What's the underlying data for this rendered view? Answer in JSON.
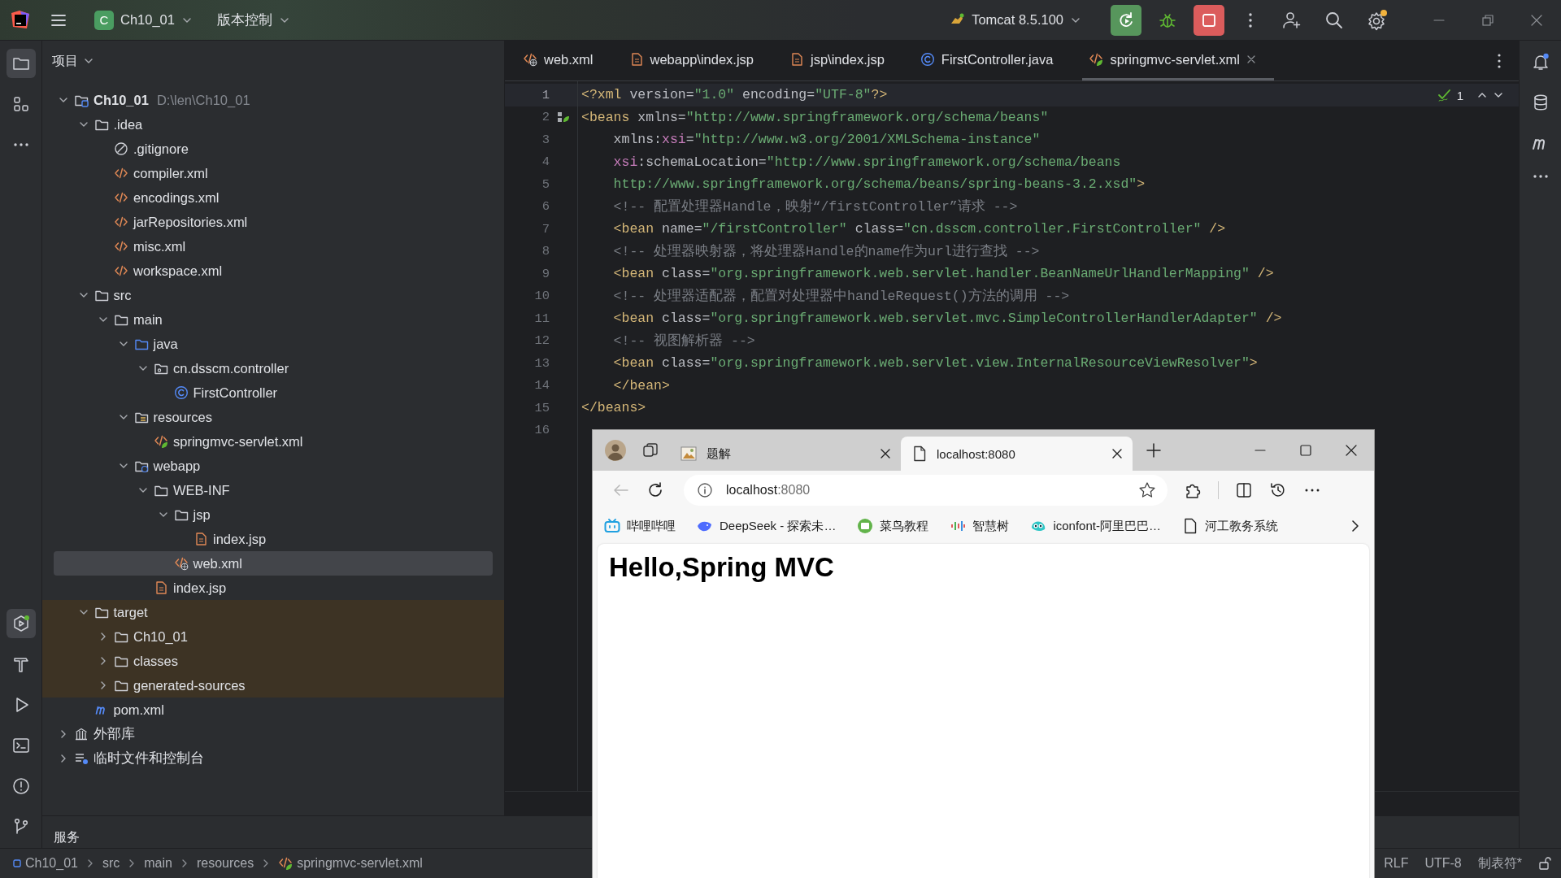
{
  "title_bar": {
    "project_badge": "C",
    "project": "Ch10_01",
    "vcs": "版本控制",
    "run_config": "Tomcat 8.5.100"
  },
  "left_toolbar": {
    "top": [
      {
        "kind": "folder",
        "selected": true
      },
      {
        "kind": "structure",
        "selected": false
      },
      {
        "kind": "more",
        "selected": false
      }
    ],
    "bottom": [
      {
        "kind": "services",
        "selected": true
      },
      {
        "kind": "build",
        "selected": false
      },
      {
        "kind": "run",
        "selected": false
      },
      {
        "kind": "terminal",
        "selected": false
      },
      {
        "kind": "problems",
        "selected": false
      },
      {
        "kind": "git",
        "selected": false
      }
    ]
  },
  "project_panel": {
    "title": "项目",
    "tree": [
      {
        "label": "Ch10_01",
        "path": "D:\\len\\Ch10_01",
        "kind": "module",
        "expanded": true,
        "selected": false,
        "excluded": false,
        "children": [
          {
            "label": ".idea",
            "kind": "folder",
            "expanded": true,
            "selected": false,
            "excluded": false,
            "children": [
              {
                "label": ".gitignore",
                "kind": "ignore",
                "selected": false,
                "excluded": false
              },
              {
                "label": "compiler.xml",
                "kind": "xml",
                "selected": false,
                "excluded": false
              },
              {
                "label": "encodings.xml",
                "kind": "xml",
                "selected": false,
                "excluded": false
              },
              {
                "label": "jarRepositories.xml",
                "kind": "xml",
                "selected": false,
                "excluded": false
              },
              {
                "label": "misc.xml",
                "kind": "xml",
                "selected": false,
                "excluded": false
              },
              {
                "label": "workspace.xml",
                "kind": "xml",
                "selected": false,
                "excluded": false
              }
            ]
          },
          {
            "label": "src",
            "kind": "folder",
            "expanded": true,
            "selected": false,
            "excluded": false,
            "children": [
              {
                "label": "main",
                "kind": "folder",
                "expanded": true,
                "selected": false,
                "excluded": false,
                "children": [
                  {
                    "label": "java",
                    "kind": "source",
                    "expanded": true,
                    "selected": false,
                    "excluded": false,
                    "children": [
                      {
                        "label": "cn.dsscm.controller",
                        "kind": "package",
                        "expanded": true,
                        "selected": false,
                        "excluded": false,
                        "children": [
                          {
                            "label": "FirstController",
                            "kind": "class",
                            "selected": false,
                            "excluded": false
                          }
                        ]
                      }
                    ]
                  },
                  {
                    "label": "resources",
                    "kind": "resources",
                    "expanded": true,
                    "selected": false,
                    "excluded": false,
                    "children": [
                      {
                        "label": "springmvc-servlet.xml",
                        "kind": "spring",
                        "selected": false,
                        "excluded": false
                      }
                    ]
                  },
                  {
                    "label": "webapp",
                    "kind": "web",
                    "expanded": true,
                    "selected": false,
                    "excluded": false,
                    "children": [
                      {
                        "label": "WEB-INF",
                        "kind": "folder",
                        "expanded": true,
                        "selected": false,
                        "excluded": false,
                        "children": [
                          {
                            "label": "jsp",
                            "kind": "folder",
                            "expanded": true,
                            "selected": false,
                            "excluded": false,
                            "children": [
                              {
                                "label": "index.jsp",
                                "kind": "jsp",
                                "selected": false,
                                "excluded": false
                              }
                            ]
                          },
                          {
                            "label": "web.xml",
                            "kind": "webxml",
                            "selected": true,
                            "excluded": false
                          }
                        ]
                      },
                      {
                        "label": "index.jsp",
                        "kind": "jsp",
                        "selected": false,
                        "excluded": false
                      }
                    ]
                  }
                ]
              }
            ]
          },
          {
            "label": "target",
            "kind": "folder",
            "expanded": true,
            "selected": false,
            "excluded": true,
            "children": [
              {
                "label": "Ch10_01",
                "kind": "folder",
                "expanded": false,
                "selected": false,
                "excluded": true
              },
              {
                "label": "classes",
                "kind": "folder",
                "expanded": false,
                "selected": false,
                "excluded": true
              },
              {
                "label": "generated-sources",
                "kind": "folder",
                "expanded": false,
                "selected": false,
                "excluded": true
              }
            ]
          },
          {
            "label": "pom.xml",
            "kind": "maven",
            "selected": false,
            "excluded": false
          }
        ]
      },
      {
        "label": "外部库",
        "kind": "library",
        "expanded": false,
        "selected": false,
        "excluded": false
      },
      {
        "label": "临时文件和控制台",
        "kind": "scratch",
        "expanded": false,
        "selected": false,
        "excluded": false
      }
    ]
  },
  "editor": {
    "tabs": [
      {
        "label": "web.xml",
        "kind": "webxml",
        "selected": false
      },
      {
        "label": "webapp\\index.jsp",
        "kind": "jsp",
        "selected": false
      },
      {
        "label": "jsp\\index.jsp",
        "kind": "jsp",
        "selected": false
      },
      {
        "label": "FirstController.java",
        "kind": "class",
        "selected": false
      },
      {
        "label": "springmvc-servlet.xml",
        "kind": "spring",
        "selected": true
      }
    ],
    "inspection_count": "1",
    "lines": [
      {
        "number": "1",
        "indent": false,
        "gutter_marker": false,
        "tokens": [
          {
            "kind": "tag",
            "t": "<?xml"
          },
          {
            "kind": "attr",
            "t": " version"
          },
          {
            "kind": "plain",
            "t": "="
          },
          {
            "kind": "str",
            "t": "\"1.0\""
          },
          {
            "kind": "attr",
            "t": " encoding"
          },
          {
            "kind": "plain",
            "t": "="
          },
          {
            "kind": "str",
            "t": "\"UTF-8\""
          },
          {
            "kind": "tag",
            "t": "?>"
          }
        ]
      },
      {
        "number": "2",
        "indent": false,
        "gutter_marker": true,
        "tokens": [
          {
            "kind": "tag",
            "t": "<beans"
          },
          {
            "kind": "attr",
            "t": " xmlns"
          },
          {
            "kind": "plain",
            "t": "="
          },
          {
            "kind": "str",
            "t": "\"http://www.springframework.org/schema/beans\""
          }
        ]
      },
      {
        "number": "3",
        "indent": true,
        "gutter_marker": false,
        "tokens": [
          {
            "kind": "attr",
            "t": "xmlns"
          },
          {
            "kind": "plain",
            "t": ":"
          },
          {
            "kind": "ns",
            "t": "xsi"
          },
          {
            "kind": "plain",
            "t": "="
          },
          {
            "kind": "str",
            "t": "\"http://www.w3.org/2001/XMLSchema-instance\""
          }
        ]
      },
      {
        "number": "4",
        "indent": true,
        "gutter_marker": false,
        "tokens": [
          {
            "kind": "ns",
            "t": "xsi"
          },
          {
            "kind": "attr",
            "t": ":schemaLocation"
          },
          {
            "kind": "plain",
            "t": "="
          },
          {
            "kind": "str",
            "t": "\"http://www.springframework.org/schema/beans"
          }
        ]
      },
      {
        "number": "5",
        "indent": true,
        "gutter_marker": false,
        "tokens": [
          {
            "kind": "str",
            "t": "http://www.springframework.org/schema/beans/spring-beans-3.2.xsd\""
          },
          {
            "kind": "tag",
            "t": ">"
          }
        ]
      },
      {
        "number": "6",
        "indent": true,
        "gutter_marker": false,
        "tokens": [
          {
            "kind": "cmt",
            "t": "<!-- 配置处理器Handle，映射“/firstController”请求 -->"
          }
        ]
      },
      {
        "number": "7",
        "indent": true,
        "gutter_marker": false,
        "tokens": [
          {
            "kind": "tag",
            "t": "<bean"
          },
          {
            "kind": "attr",
            "t": " name"
          },
          {
            "kind": "plain",
            "t": "="
          },
          {
            "kind": "str",
            "t": "\"/firstController\""
          },
          {
            "kind": "attr",
            "t": " class"
          },
          {
            "kind": "plain",
            "t": "="
          },
          {
            "kind": "str",
            "t": "\"cn.dsscm.controller.FirstController\""
          },
          {
            "kind": "tag",
            "t": " />"
          }
        ]
      },
      {
        "number": "8",
        "indent": true,
        "gutter_marker": false,
        "tokens": [
          {
            "kind": "cmt",
            "t": "<!-- 处理器映射器，将处理器Handle的name作为url进行查找 -->"
          }
        ]
      },
      {
        "number": "9",
        "indent": true,
        "gutter_marker": false,
        "tokens": [
          {
            "kind": "tag",
            "t": "<bean"
          },
          {
            "kind": "attr",
            "t": " class"
          },
          {
            "kind": "plain",
            "t": "="
          },
          {
            "kind": "str",
            "t": "\"org.springframework.web.servlet.handler.BeanNameUrlHandlerMapping\""
          },
          {
            "kind": "tag",
            "t": " />"
          }
        ]
      },
      {
        "number": "10",
        "indent": true,
        "gutter_marker": false,
        "tokens": [
          {
            "kind": "cmt",
            "t": "<!-- 处理器适配器，配置对处理器中handleRequest()方法的调用 -->"
          }
        ]
      },
      {
        "number": "11",
        "indent": true,
        "gutter_marker": false,
        "tokens": [
          {
            "kind": "tag",
            "t": "<bean"
          },
          {
            "kind": "attr",
            "t": " class"
          },
          {
            "kind": "plain",
            "t": "="
          },
          {
            "kind": "str",
            "t": "\"org.springframework.web.servlet.mvc.SimpleControllerHandlerAdapter\""
          },
          {
            "kind": "tag",
            "t": " />"
          }
        ]
      },
      {
        "number": "12",
        "indent": true,
        "gutter_marker": false,
        "tokens": [
          {
            "kind": "cmt",
            "t": "<!-- 视图解析器 -->"
          }
        ]
      },
      {
        "number": "13",
        "indent": true,
        "gutter_marker": false,
        "tokens": [
          {
            "kind": "tag",
            "t": "<bean"
          },
          {
            "kind": "attr",
            "t": " class"
          },
          {
            "kind": "plain",
            "t": "="
          },
          {
            "kind": "str",
            "t": "\"org.springframework.web.servlet.view.InternalResourceViewResolver\""
          },
          {
            "kind": "tag",
            "t": ">"
          }
        ]
      },
      {
        "number": "14",
        "indent": true,
        "gutter_marker": false,
        "tokens": [
          {
            "kind": "tag",
            "t": "</bean>"
          }
        ]
      },
      {
        "number": "15",
        "indent": false,
        "gutter_marker": false,
        "tokens": [
          {
            "kind": "tag",
            "t": "</beans>"
          }
        ]
      },
      {
        "number": "16",
        "gutter_marker": false
      }
    ]
  },
  "right_toolbar": [
    {
      "kind": "bell"
    },
    {
      "kind": "database"
    },
    {
      "kind": "maven"
    },
    {
      "kind": "more"
    }
  ],
  "services_panel": {
    "title": "服务"
  },
  "status_bar": {
    "breadcrumbs": [
      {
        "label": "Ch10_01",
        "kind": "module"
      },
      {
        "label": "src",
        "kind": "plain"
      },
      {
        "label": "main",
        "kind": "plain"
      },
      {
        "label": "resources",
        "kind": "plain"
      },
      {
        "label": "springmvc-servlet.xml",
        "kind": "spring"
      }
    ],
    "items": [
      "RLF",
      "UTF-8",
      "制表符*"
    ]
  },
  "browser": {
    "tabs": [
      {
        "label": "题解",
        "kind": "image",
        "selected": false
      },
      {
        "label": "localhost:8080",
        "kind": "page",
        "selected": true
      }
    ],
    "back_disabled": true,
    "address": {
      "host": "localhost",
      "port": ":8080"
    },
    "bookmarks": [
      {
        "label": "哔哩哔哩",
        "kind": "tv"
      },
      {
        "label": "DeepSeek - 探索未…",
        "kind": "whale"
      },
      {
        "label": "菜鸟教程",
        "kind": "code"
      },
      {
        "label": "智慧树",
        "kind": "bars"
      },
      {
        "label": "iconfont-阿里巴巴…",
        "kind": "chameleon"
      },
      {
        "label": "河工教务系统",
        "kind": "page"
      }
    ],
    "heading": "Hello,Spring MVC"
  }
}
